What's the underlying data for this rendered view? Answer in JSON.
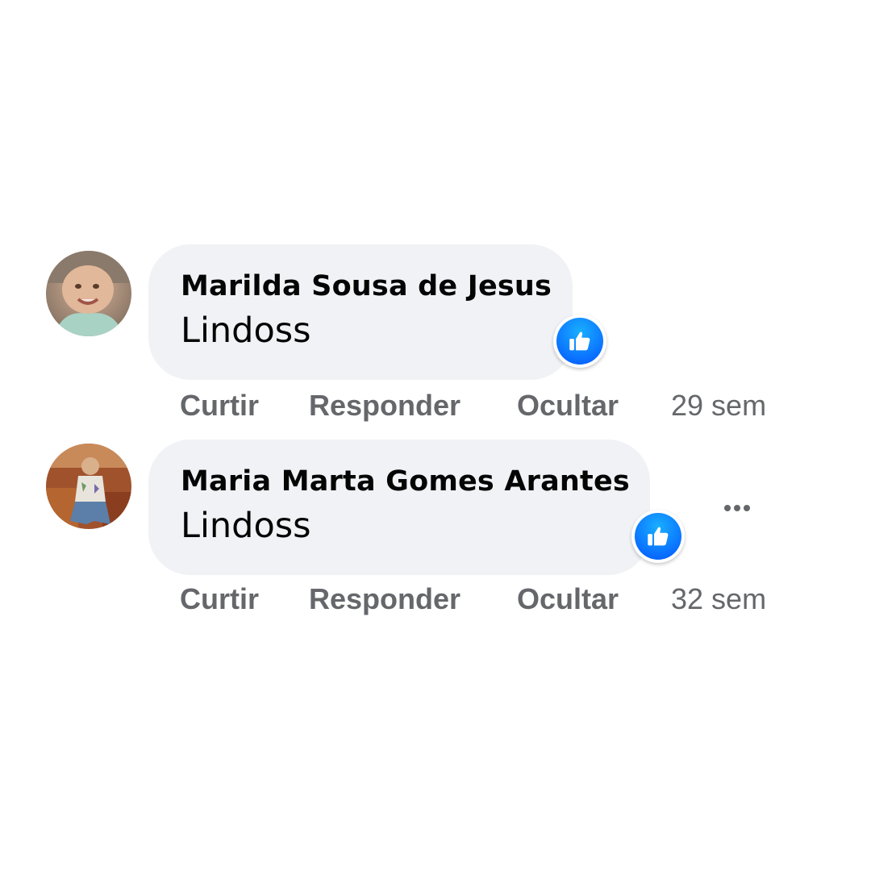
{
  "comments": [
    {
      "author": "Marilda Sousa de Jesus",
      "text": "Lindoss",
      "reaction": "like-icon",
      "actions": {
        "like": "Curtir",
        "reply": "Responder",
        "hide": "Ocultar"
      },
      "timestamp": "29 sem",
      "avatar": "avatar-photo"
    },
    {
      "author": "Maria Marta Gomes Arantes",
      "text": "Lindoss",
      "reaction": "like-icon",
      "actions": {
        "like": "Curtir",
        "reply": "Responder",
        "hide": "Ocultar"
      },
      "timestamp": "32 sem",
      "avatar": "avatar-photo",
      "more_menu": "more-options-icon"
    }
  ],
  "colors": {
    "bubble_background": "#f0f2f5",
    "text_primary": "#050505",
    "text_secondary": "#65676b",
    "like_blue": "#0866ff"
  }
}
